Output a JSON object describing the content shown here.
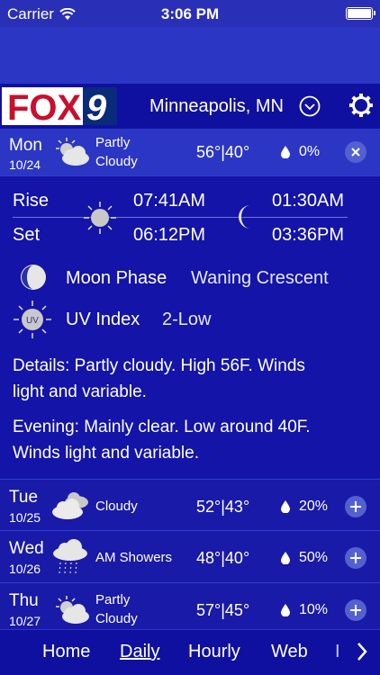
{
  "status": {
    "carrier": "Carrier",
    "time": "3:06 PM"
  },
  "header": {
    "logo_text": "FOX",
    "logo_num": "9",
    "city": "Minneapolis, MN"
  },
  "current": {
    "day": "Mon",
    "date": "10/24",
    "condition_line1": "Partly",
    "condition_line2": "Cloudy",
    "high": "56°",
    "sep": "|",
    "low": "40°",
    "precip": "0%"
  },
  "details": {
    "rise_label": "Rise",
    "set_label": "Set",
    "sunrise": "07:41AM",
    "sunset": "06:12PM",
    "moonrise": "01:30AM",
    "moonset": "03:36PM",
    "moon_phase_label": "Moon Phase",
    "moon_phase_value": "Waning Crescent",
    "uv_label": "UV Index",
    "uv_value": "2-Low",
    "uv_icon_text": "UV",
    "details_line1": "Details: Partly cloudy. High 56F. Winds",
    "details_line2": "light and variable.",
    "evening_line1": "Evening: Mainly clear. Low around 40F.",
    "evening_line2": "Winds light and variable."
  },
  "forecast": [
    {
      "day": "Tue",
      "date": "10/25",
      "condition_line1": "Cloudy",
      "condition_line2": "",
      "high": "52°",
      "low": "43°",
      "precip": "20%"
    },
    {
      "day": "Wed",
      "date": "10/26",
      "condition_line1": "AM Showers",
      "condition_line2": "",
      "high": "48°",
      "low": "40°",
      "precip": "50%"
    },
    {
      "day": "Thu",
      "date": "10/27",
      "condition_line1": "Partly",
      "condition_line2": "Cloudy",
      "high": "57°",
      "low": "45°",
      "precip": "10%"
    }
  ],
  "nav": {
    "home": "Home",
    "daily": "Daily",
    "hourly": "Hourly",
    "web": "Web",
    "more_partial": "I"
  },
  "colors": {
    "background": "#1a1aa8",
    "header": "#1010a0",
    "accent": "#5361d0"
  }
}
